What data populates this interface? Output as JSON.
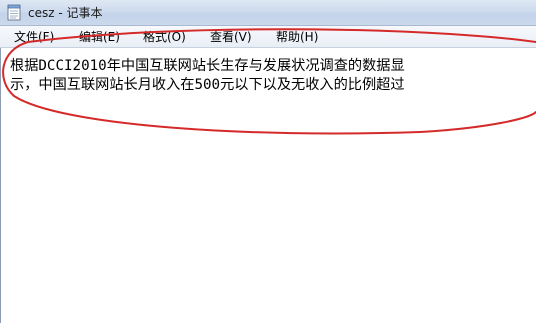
{
  "window": {
    "title": "cesz - 记事本"
  },
  "menu": [
    {
      "label": "文件(F)"
    },
    {
      "label": "编辑(E)"
    },
    {
      "label": "格式(O)"
    },
    {
      "label": "查看(V)"
    },
    {
      "label": "帮助(H)"
    }
  ],
  "editor": {
    "lines": [
      "根据DCCI2010年中国互联网站长生存与发展状况调查的数据显",
      "示，中国互联网站长月收入在500元以下以及无收入的比例超过"
    ]
  },
  "annotation": {
    "shape": "ellipse",
    "color": "#d42a2a"
  }
}
